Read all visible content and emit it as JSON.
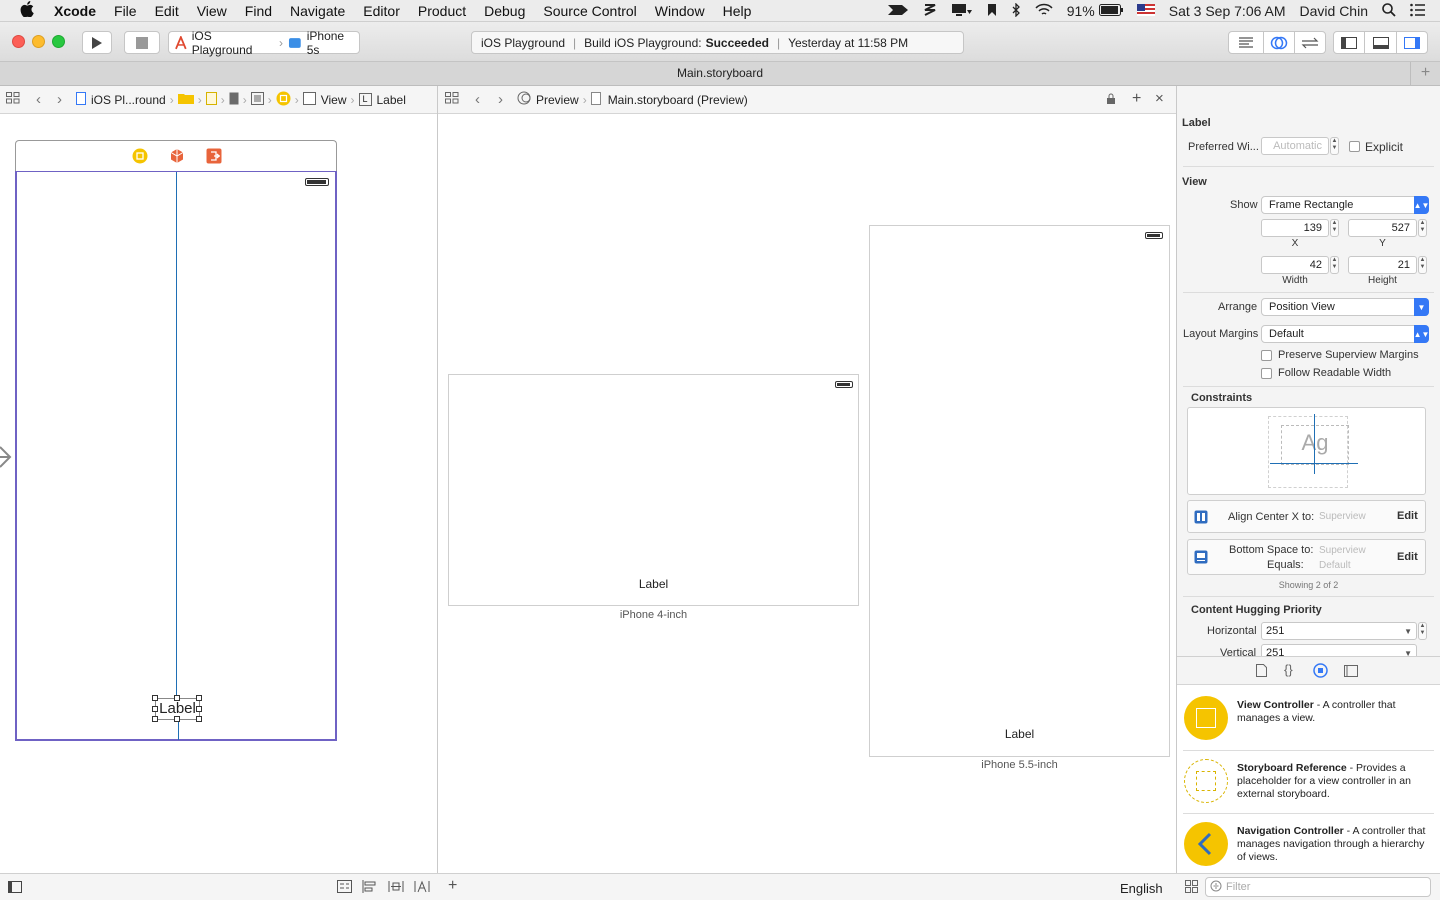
{
  "menubar": {
    "app_name": "Xcode",
    "items": [
      "File",
      "Edit",
      "View",
      "Find",
      "Navigate",
      "Editor",
      "Product",
      "Debug",
      "Source Control",
      "Window",
      "Help"
    ],
    "battery": "91%",
    "datetime": "Sat 3 Sep  7:06 AM",
    "user": "David Chin"
  },
  "toolbar": {
    "scheme": "iOS Playground",
    "destination": "iPhone 5s",
    "activity_project": "iOS Playground",
    "activity_status_prefix": "Build iOS Playground:",
    "activity_status": "Succeeded",
    "activity_time": "Yesterday at 11:58 PM"
  },
  "tab": {
    "title": "Main.storyboard"
  },
  "left_jumpbar": {
    "project": "iOS Pl...round",
    "view": "View",
    "label": "Label"
  },
  "center_jumpbar": {
    "preview": "Preview",
    "file": "Main.storyboard (Preview)"
  },
  "canvas": {
    "label_text": "Label"
  },
  "previews": [
    {
      "label": "Label",
      "caption": "iPhone 4-inch"
    },
    {
      "label": "Label",
      "caption": "iPhone 5.5-inch"
    }
  ],
  "inspector": {
    "label_section": "Label",
    "preferred_width_label": "Preferred Wi...",
    "preferred_width_placeholder": "Automatic",
    "explicit_label": "Explicit",
    "view_section": "View",
    "show_label": "Show",
    "show_value": "Frame Rectangle",
    "x_value": "139",
    "y_value": "527",
    "x_label": "X",
    "y_label": "Y",
    "width_value": "42",
    "height_value": "21",
    "width_label": "Width",
    "height_label": "Height",
    "arrange_label": "Arrange",
    "arrange_value": "Position View",
    "layout_margins_label": "Layout Margins",
    "layout_margins_value": "Default",
    "preserve_margins": "Preserve Superview Margins",
    "follow_readable": "Follow Readable Width",
    "constraints_section": "Constraints",
    "constraints_ag": "Ag",
    "constraint1_title": "Align Center X to:",
    "constraint1_target": "Superview",
    "constraint2_title": "Bottom Space to:",
    "constraint2_target": "Superview",
    "constraint2_equals_label": "Equals:",
    "constraint2_equals": "Default",
    "edit_label": "Edit",
    "showing_count": "Showing 2 of 2",
    "hugging_section": "Content Hugging Priority",
    "horizontal_label": "Horizontal",
    "horizontal_value": "251",
    "vertical_label": "Vertical",
    "vertical_value": "251"
  },
  "library": {
    "items": [
      {
        "title": "View Controller",
        "desc": " - A controller that manages a view."
      },
      {
        "title": "Storyboard Reference",
        "desc": " - Provides a placeholder for a view controller in an external storyboard."
      },
      {
        "title": "Navigation Controller",
        "desc": " - A controller that manages navigation through a hierarchy of views."
      }
    ],
    "filter_placeholder": "Filter"
  },
  "bottombar": {
    "language": "English"
  },
  "colors": {
    "accent": "#3478f6",
    "vc_yellow": "#f5c400",
    "selection": "#4a6fd1"
  }
}
